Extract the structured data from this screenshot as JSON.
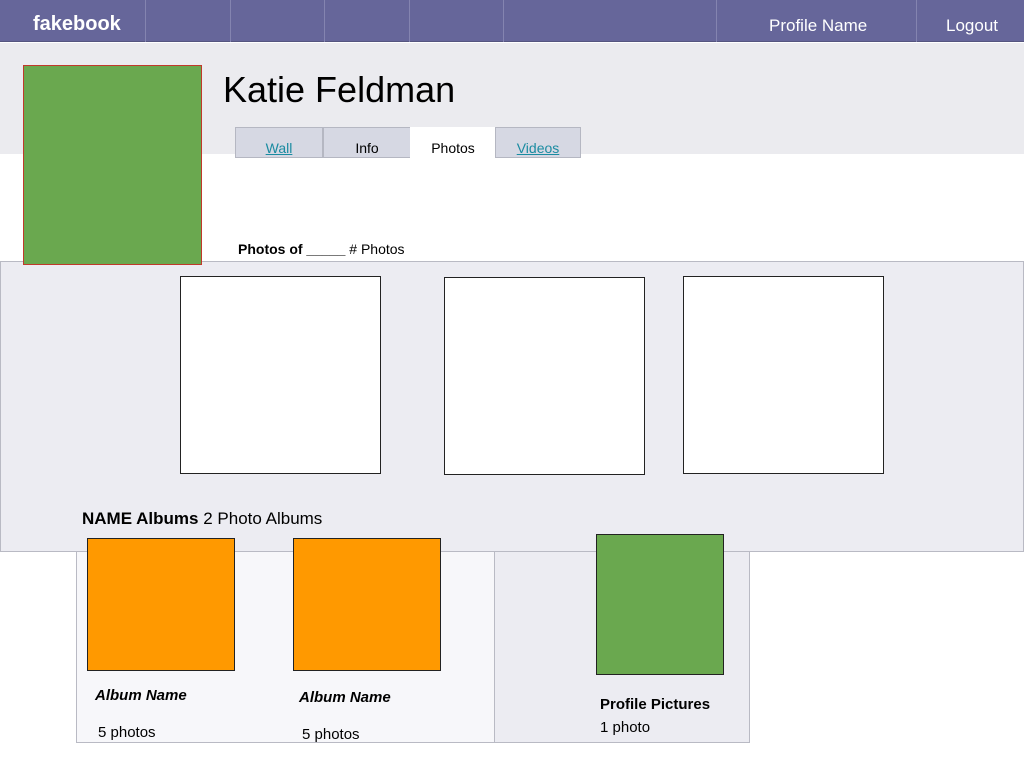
{
  "topbar": {
    "logo": "fakebook",
    "profile_link": "Profile Name",
    "logout_link": "Logout"
  },
  "profile": {
    "name": "Katie Feldman",
    "photo_color": "#6aa84f"
  },
  "tabs": [
    {
      "label": "Wall",
      "link": true
    },
    {
      "label": "Info",
      "link": false
    },
    {
      "label": "Photos",
      "link": false,
      "active": true
    },
    {
      "label": "Videos",
      "link": true
    }
  ],
  "photos": {
    "heading_bold": "Photos of _____",
    "heading_count": "# Photos"
  },
  "albums": {
    "heading_bold": "NAME Albums",
    "heading_count": "2 Photo Albums",
    "items": [
      {
        "name": "Album Name",
        "count": "5 photos",
        "color": "#ff9900"
      },
      {
        "name": "Album Name",
        "count": "5 photos",
        "color": "#ff9900"
      }
    ],
    "profile_pictures": {
      "name": "Profile Pictures",
      "count": "1 photo",
      "color": "#6aa84f"
    }
  },
  "colors": {
    "topbar": "#66669a",
    "tab_link": "#1a8ba1",
    "panel": "#ececf2"
  }
}
